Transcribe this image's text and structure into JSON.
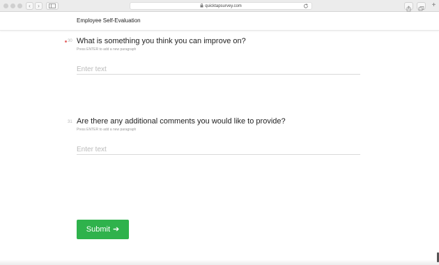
{
  "browser": {
    "url": "quicktapsurvey.com"
  },
  "header": {
    "title": "Employee Self-Evaluation"
  },
  "questions": [
    {
      "number": "30",
      "text": "What is something you think you can improve on?",
      "hint": "Press ENTER to add a new paragraph",
      "placeholder": "Enter text",
      "required": true
    },
    {
      "number": "31",
      "text": "Are there any additional comments you would like to provide?",
      "hint": "Press ENTER to add a new paragraph",
      "placeholder": "Enter text",
      "required": false
    }
  ],
  "submit": {
    "label": "Submit",
    "arrow": "➔"
  },
  "colors": {
    "accent": "#2fb24c",
    "required_dot": "#e46a6a"
  },
  "icons": [
    "back-icon",
    "forward-icon",
    "sidebar-icon",
    "lock-icon",
    "reload-icon",
    "share-icon",
    "tabs-icon",
    "new-tab-icon",
    "arrow-right-icon"
  ]
}
